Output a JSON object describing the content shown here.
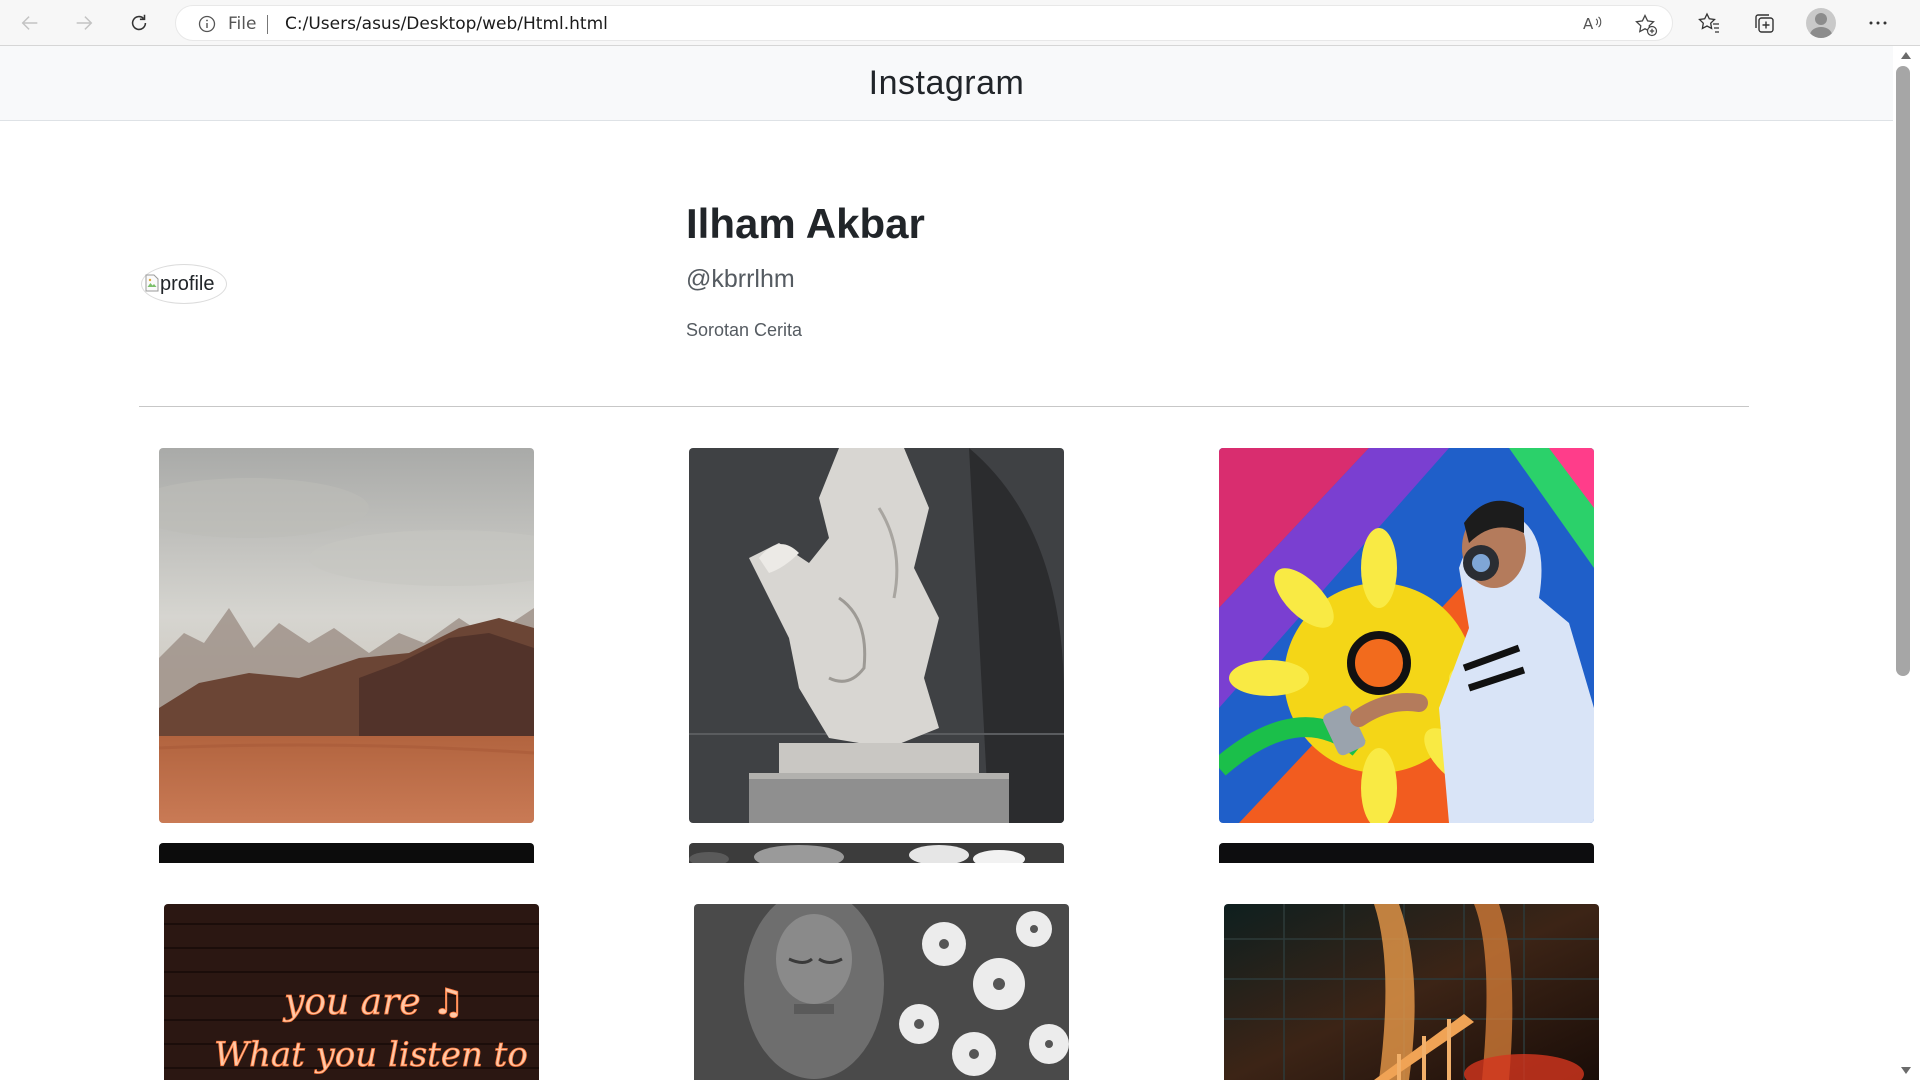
{
  "browser": {
    "scheme_label": "File",
    "url": "C:/Users/asus/Desktop/web/Html.html",
    "icons": [
      "back-icon",
      "forward-icon",
      "refresh-icon",
      "info-icon",
      "read-aloud-icon",
      "add-favorite-icon",
      "favorites-icon",
      "collections-icon",
      "profile-avatar",
      "more-icon"
    ]
  },
  "header": {
    "brand": "Instagram"
  },
  "profile": {
    "image_alt": "profile",
    "name": "Ilham Akbar",
    "handle": "@kbrrlhm",
    "bio": "Sorotan Cerita"
  },
  "posts": [
    {
      "subject": "desert-mountains"
    },
    {
      "subject": "marble-statue"
    },
    {
      "subject": "graffiti-artist"
    },
    {
      "subject": "dark-strip"
    },
    {
      "subject": "flowers-strip"
    },
    {
      "subject": "dark-strip"
    },
    {
      "subject": "neon-sign",
      "neon_text": [
        "you are",
        "What you listen to"
      ]
    },
    {
      "subject": "buddha-flowers"
    },
    {
      "subject": "fire-staircase"
    }
  ],
  "colors": {
    "accent_neon": "#ff9b6a",
    "header_bg": "#f8f9fa",
    "text": "#212529"
  }
}
